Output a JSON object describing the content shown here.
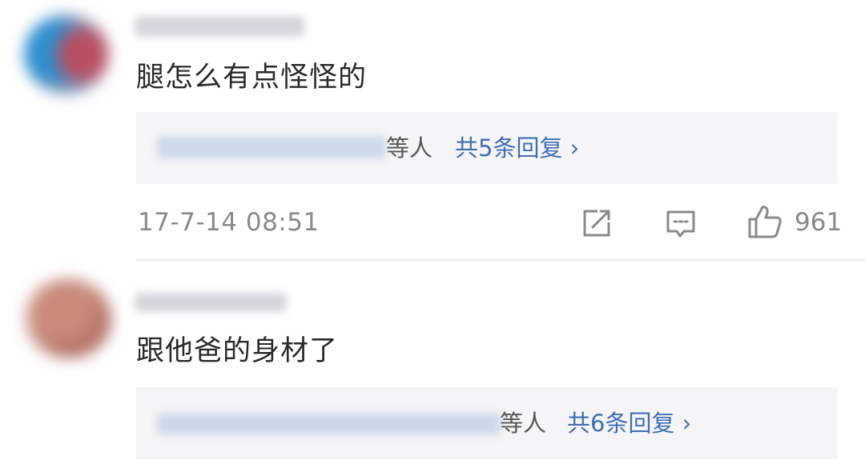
{
  "comments": [
    {
      "text": "腿怎么有点怪怪的",
      "reply_suffix": "等人",
      "reply_count_label": "共5条回复 ›",
      "timestamp": "17-7-14 08:51",
      "like_count": "961",
      "icons": [
        "share-icon",
        "reply-icon",
        "like-icon"
      ]
    },
    {
      "text": "跟他爸的身材了",
      "reply_suffix": "等人",
      "reply_count_label": "共6条回复 ›"
    }
  ],
  "colors": {
    "text": "#2a2a2a",
    "muted": "#8a8a8a",
    "link": "#3f6fb3",
    "reply_box_bg": "#f5f5f7",
    "divider": "#ececec"
  }
}
